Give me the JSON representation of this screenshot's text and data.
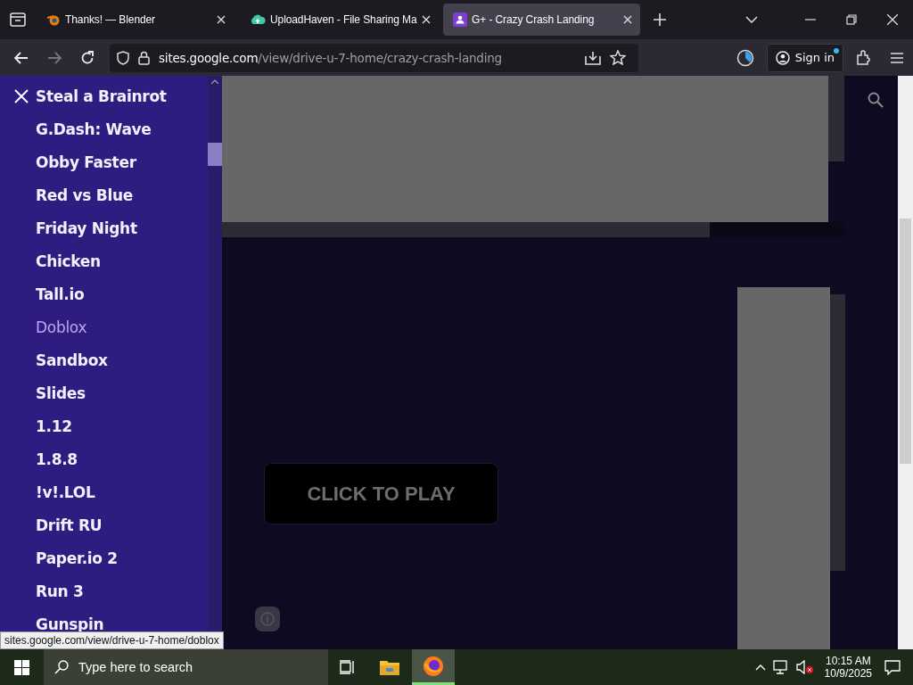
{
  "browser": {
    "tabs": [
      {
        "title": "Thanks! — Blender",
        "selected": false
      },
      {
        "title": "UploadHaven - File Sharing Ma",
        "selected": false
      },
      {
        "title": "G+ - Crazy Crash Landing",
        "selected": true
      }
    ],
    "address": {
      "host": "sites.google.com",
      "path": "/view/drive-u-7-home/crazy-crash-landing"
    },
    "sign_in": "Sign in"
  },
  "sidebar": {
    "items": [
      {
        "label": "Steal a Brainrot",
        "hovered": false
      },
      {
        "label": "G.Dash: Wave",
        "hovered": false
      },
      {
        "label": "Obby Faster",
        "hovered": false
      },
      {
        "label": "Red vs Blue",
        "hovered": false
      },
      {
        "label": "Friday Night",
        "hovered": false
      },
      {
        "label": "Chicken",
        "hovered": false
      },
      {
        "label": "Tall.io",
        "hovered": false
      },
      {
        "label": "Doblox",
        "hovered": true
      },
      {
        "label": "Sandbox",
        "hovered": false
      },
      {
        "label": "Slides",
        "hovered": false
      },
      {
        "label": "1.12",
        "hovered": false
      },
      {
        "label": "1.8.8",
        "hovered": false
      },
      {
        "label": "!v!.LOL",
        "hovered": false
      },
      {
        "label": "Drift RU",
        "hovered": false
      },
      {
        "label": "Paper.io 2",
        "hovered": false
      },
      {
        "label": "Run 3",
        "hovered": false
      },
      {
        "label": "Gunspin",
        "hovered": false
      }
    ]
  },
  "game": {
    "play_button": "CLICK TO PLAY"
  },
  "status_url": "sites.google.com/view/drive-u-7-home/doblox",
  "taskbar": {
    "search_placeholder": "Type here to search",
    "time": "10:15 AM",
    "date": "10/9/2025"
  }
}
